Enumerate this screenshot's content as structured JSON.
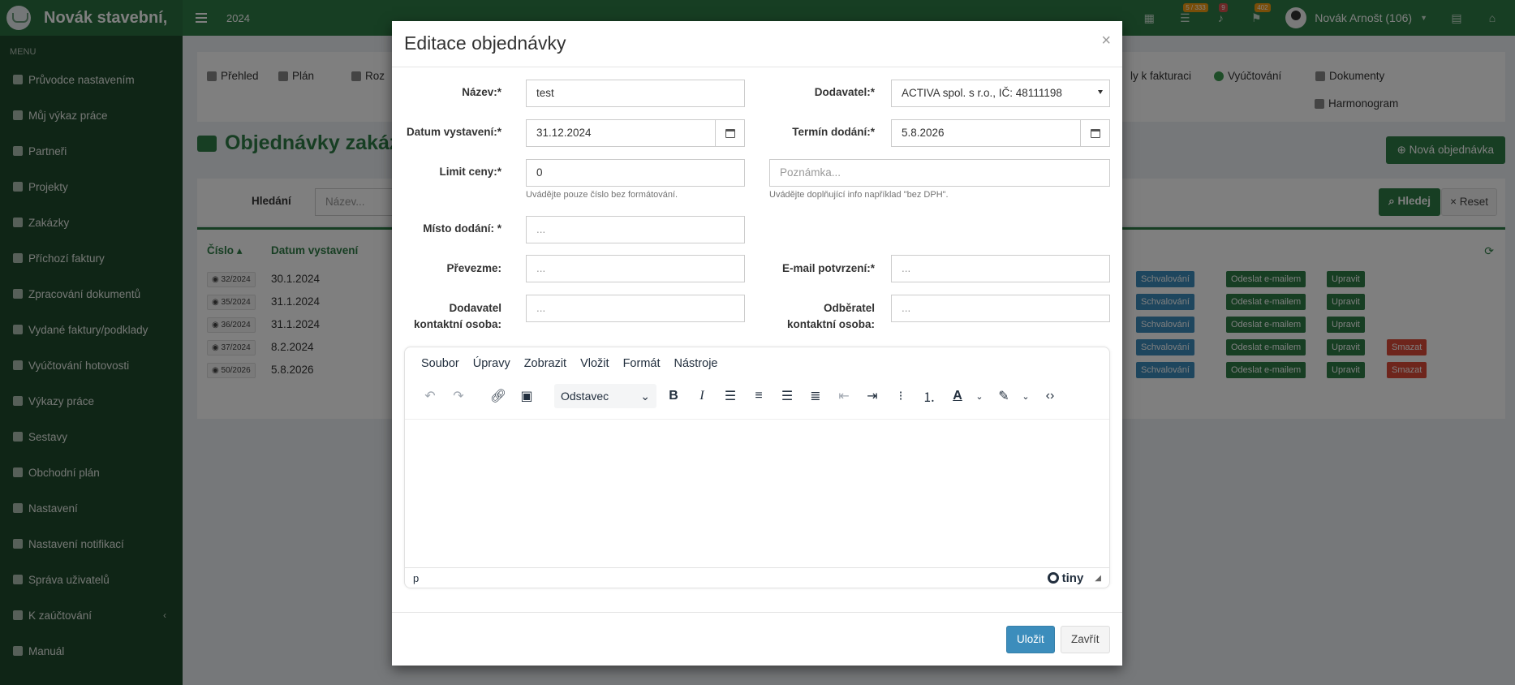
{
  "header": {
    "brand": "Novák stavební,",
    "year": "2024",
    "badge_tasks": "5 / 333",
    "badge_bell": "9",
    "badge_flag": "402",
    "user_name": "Novák Arnošt (106)"
  },
  "sidebar": {
    "menu_title": "MENU",
    "items": [
      {
        "label": "Průvodce nastavením"
      },
      {
        "label": "Můj výkaz práce"
      },
      {
        "label": "Partneři"
      },
      {
        "label": "Projekty"
      },
      {
        "label": "Zakázky"
      },
      {
        "label": "Příchozí faktury"
      },
      {
        "label": "Zpracování dokumentů"
      },
      {
        "label": "Vydané faktury/podklady"
      },
      {
        "label": "Vyúčtování hotovosti"
      },
      {
        "label": "Výkazy práce"
      },
      {
        "label": "Sestavy"
      },
      {
        "label": "Obchodní plán"
      },
      {
        "label": "Nastavení"
      },
      {
        "label": "Nastavení notifikací"
      },
      {
        "label": "Správa uživatelů"
      },
      {
        "label": "K zaúčtování"
      },
      {
        "label": "Manuál"
      }
    ]
  },
  "main": {
    "tabs": {
      "prehled": "Přehled",
      "plan": "Plán",
      "roz": "Roz",
      "k_fakturaci": "ly k fakturaci",
      "vyuctovani": "Vyúčtování",
      "dokumenty": "Dokumenty",
      "harmonogram": "Harmonogram"
    },
    "page_title": "Objednávky zakáz",
    "new_button": "Nová objednávka",
    "search": {
      "label": "Hledání",
      "placeholder": "Název...",
      "search_button": "Hledej",
      "reset_button": "Reset"
    },
    "table": {
      "col_number": "Číslo",
      "col_date": "Datum vystavení",
      "approve_label": "Schvalování",
      "email_label": "Odeslat e-mailem",
      "edit_label": "Upravit",
      "delete_label": "Smazat",
      "rows": [
        {
          "number": "32/2024",
          "date": "30.1.2024"
        },
        {
          "number": "35/2024",
          "date": "31.1.2024"
        },
        {
          "number": "36/2024",
          "date": "31.1.2024"
        },
        {
          "number": "37/2024",
          "date": "8.2.2024"
        },
        {
          "number": "50/2026",
          "date": "5.8.2026"
        }
      ]
    }
  },
  "modal": {
    "title": "Editace objednávky",
    "close_symbol": "×",
    "fields": {
      "nazev": {
        "label": "Název:*",
        "value": "test"
      },
      "dodavatel": {
        "label": "Dodavatel:*",
        "value": "ACTIVA spol. s r.o., IČ: 48111198"
      },
      "datum_vystaveni": {
        "label": "Datum vystavení:*",
        "value": "31.12.2024"
      },
      "termin_dodani": {
        "label": "Termín dodání:*",
        "value": "5.8.2026"
      },
      "limit_ceny": {
        "label": "Limit ceny:*",
        "value": "0",
        "help": "Uvádějte pouze číslo bez formátování."
      },
      "poznamka": {
        "placeholder": "Poznámka...",
        "help": "Uvádějte doplňující info například \"bez DPH\"."
      },
      "misto_dodani": {
        "label": "Místo dodání: *",
        "placeholder": "..."
      },
      "prevezme": {
        "label": "Převezme:",
        "placeholder": "..."
      },
      "email_potvrzeni": {
        "label": "E-mail potvrzení:*",
        "placeholder": "..."
      },
      "dodavatel_kontakt": {
        "label_line1": "Dodavatel",
        "label_line2": "kontaktní osoba:",
        "placeholder": "..."
      },
      "odberatel_kontakt": {
        "label_line1": "Odběratel",
        "label_line2": "kontaktní osoba:",
        "placeholder": "..."
      }
    },
    "editor": {
      "menu": [
        "Soubor",
        "Úpravy",
        "Zobrazit",
        "Vložit",
        "Formát",
        "Nástroje"
      ],
      "block_format": "Odstavec",
      "status_path": "p",
      "brand": "tiny"
    },
    "save_button": "Uložit",
    "close_button": "Zavřít"
  }
}
